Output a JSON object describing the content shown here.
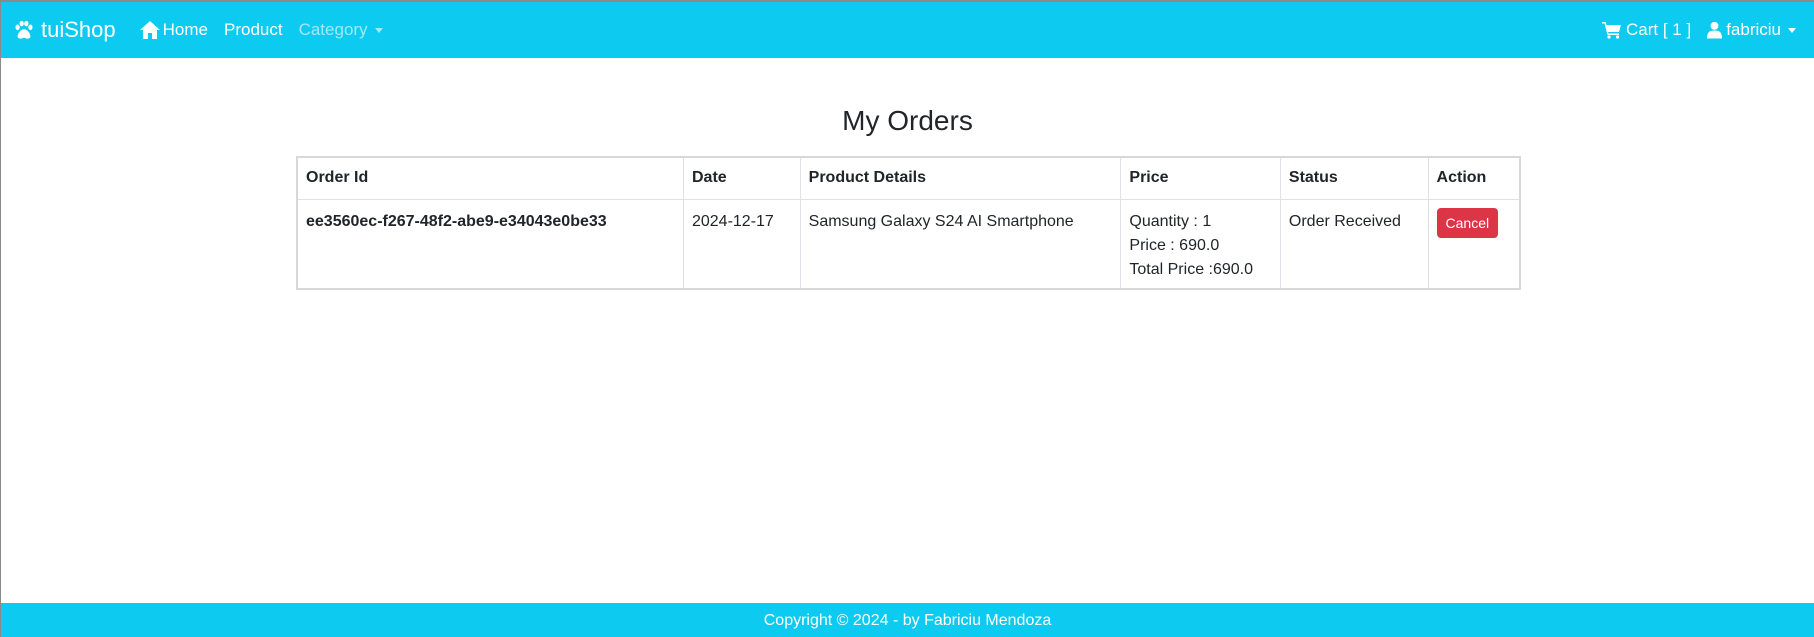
{
  "navbar": {
    "brand": "tuiShop",
    "brand_icon": "paw-icon",
    "home_label": "Home",
    "product_label": "Product",
    "category_label": "Category",
    "cart_label": "Cart [ 1 ]",
    "user_label": "fabriciu",
    "colors": {
      "background": "#0dcaf0",
      "text": "#ffffff"
    }
  },
  "main": {
    "title": "My Orders",
    "table": {
      "headers": [
        "Order Id",
        "Date",
        "Product Details",
        "Price",
        "Status",
        "Action"
      ],
      "rows": [
        {
          "order_id": "ee3560ec-f267-48f2-abe9-e34043e0be33",
          "date": "2024-12-17",
          "product_details": "Samsung Galaxy S24 AI Smartphone",
          "price_lines": [
            "Quantity : 1",
            "Price : 690.0",
            "Total Price :690.0"
          ],
          "status": "Order Received",
          "action_label": "Cancel"
        }
      ]
    },
    "colors": {
      "cancel_button": "#dc3545"
    }
  },
  "footer": {
    "text": "Copyright © 2024 - by Fabriciu Mendoza"
  }
}
